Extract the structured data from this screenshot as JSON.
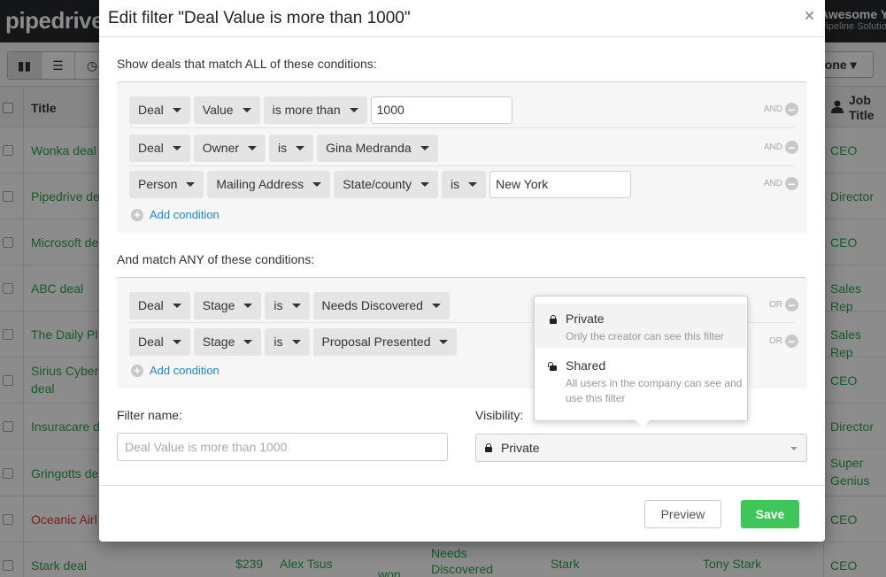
{
  "app": {
    "logo": "pipedrive",
    "company_line1": "Awesome Yo",
    "company_line2": "Pipeline Solutions",
    "owner_filter": "yone",
    "columns": {
      "title": "Title",
      "job_title": "Job Title"
    },
    "rows": [
      {
        "title": "Wonka deal",
        "job": "CEO",
        "status": "open"
      },
      {
        "title": "Pipedrive de",
        "job": "Director",
        "status": "open"
      },
      {
        "title": "Microsoft de",
        "job": "CEO",
        "status": "open"
      },
      {
        "title": "ABC deal",
        "job": "Sales Rep",
        "status": "open"
      },
      {
        "title": "The Daily Pl",
        "job": "Sales Rep",
        "status": "open"
      },
      {
        "title": "Sirius Cyber deal",
        "job": "CEO",
        "status": "open"
      },
      {
        "title": "Insuracare d",
        "job": "Director",
        "status": "open"
      },
      {
        "title": "Gringotts de",
        "job": "Super Genius",
        "status": "open"
      },
      {
        "title": "Oceanic Airl",
        "job": "CEO",
        "status": "lost"
      },
      {
        "title": "Stark deal",
        "job": "CEO",
        "status": "open",
        "value": "$239",
        "owner": "Alex Tsus",
        "deal_status": "won",
        "stage": "Needs Discovered",
        "org": "Stark",
        "person": "Tony Stark"
      }
    ]
  },
  "dialog": {
    "title": "Edit filter \"Deal Value is more than 1000\"",
    "close": "×",
    "all_label": "Show deals that match ALL of these conditions:",
    "any_label": "And match ANY of these conditions:",
    "all_conditions": [
      {
        "parts": [
          "Deal",
          "Value",
          "is more than"
        ],
        "input": "1000",
        "op": "AND"
      },
      {
        "parts": [
          "Deal",
          "Owner",
          "is",
          "Gina Medranda"
        ],
        "op": "AND"
      },
      {
        "parts": [
          "Person",
          "Mailing Address",
          "State/county",
          "is"
        ],
        "input": "New York",
        "op": "AND"
      }
    ],
    "any_conditions": [
      {
        "parts": [
          "Deal",
          "Stage",
          "is",
          "Needs Discovered"
        ],
        "op": "OR"
      },
      {
        "parts": [
          "Deal",
          "Stage",
          "is",
          "Proposal Presented"
        ],
        "op": "OR"
      }
    ],
    "add_condition": "Add condition",
    "filter_name_label": "Filter name:",
    "filter_name_placeholder": "Deal Value is more than 1000",
    "visibility_label": "Visibility:",
    "visibility_value": "Private",
    "visibility_options": [
      {
        "title": "Private",
        "desc": "Only the creator can see this filter",
        "icon": "lock-icon"
      },
      {
        "title": "Shared",
        "desc": "All users in the company can see and use this filter",
        "icon": "unlock-icon"
      }
    ],
    "preview": "Preview",
    "save": "Save"
  },
  "colors": {
    "accent_green": "#3fc659",
    "link_blue": "#1b8ad3",
    "lost_red": "#e0352b",
    "header_dark": "#26292c"
  }
}
